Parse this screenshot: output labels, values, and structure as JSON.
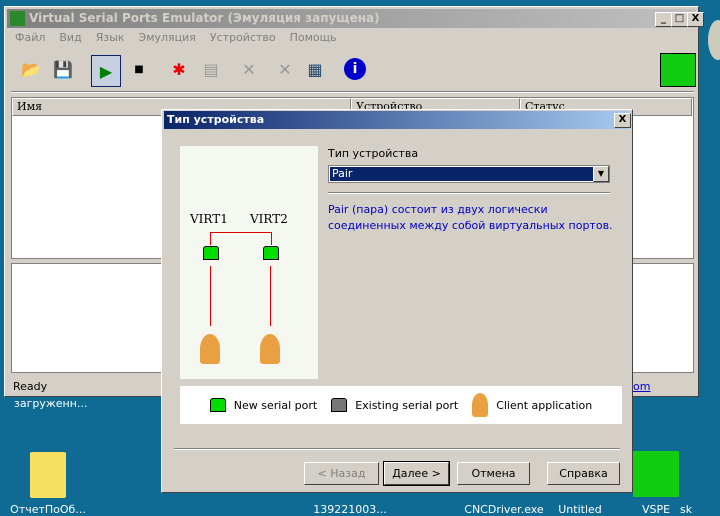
{
  "window": {
    "title": "Virtual Serial Ports Emulator (Эмуляция запущена)",
    "minimize": "_",
    "maximize": "□",
    "close": "X"
  },
  "menu": [
    "Файл",
    "Вид",
    "Язык",
    "Эмуляция",
    "Устройство",
    "Помощь"
  ],
  "list": {
    "columns": [
      "Имя",
      "Устройство",
      "Статус"
    ]
  },
  "status": {
    "text": "Ready",
    "link": "om"
  },
  "dialog": {
    "title": "Тип устройства",
    "close": "X",
    "type_label": "Тип устройства",
    "type_value": "Pair",
    "description": "Pair (пара) состоит из двух логически соединенных между собой виртуальных портов.",
    "diagram": {
      "port1": "VIRT1",
      "port2": "VIRT2"
    },
    "legend": {
      "new": "New serial port",
      "existing": "Existing serial port",
      "client": "Client application"
    },
    "buttons": {
      "back": "< Назад",
      "next": "Далее >",
      "cancel": "Отмена",
      "help": "Справка"
    }
  },
  "desktop": {
    "icons": [
      "загруженн...",
      "ОтчетПоОб...",
      "139221003...",
      "CNCDriver.exe",
      "Untitled",
      "VSPE",
      "sk"
    ]
  },
  "colors": {
    "desktop": "#0f6b94",
    "title_active": "#0a246a",
    "description": "#0000c0",
    "port_new": "#00d000"
  }
}
